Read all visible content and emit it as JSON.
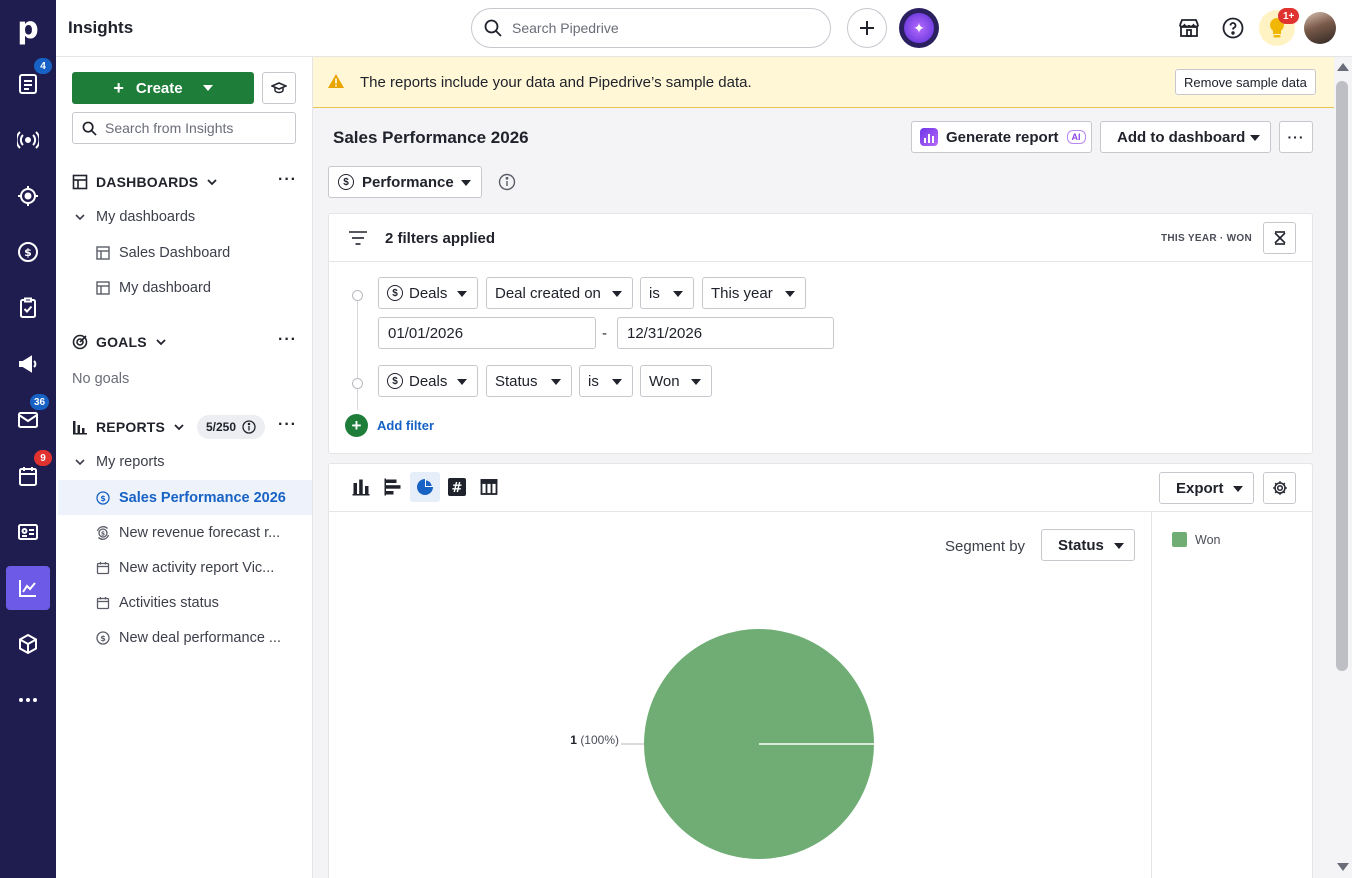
{
  "app": {
    "logo": "p",
    "title": "Insights"
  },
  "rail": {
    "badges": {
      "leads": "4",
      "mail": "36",
      "activities": "9"
    }
  },
  "topbar": {
    "search_placeholder": "Search Pipedrive",
    "notification_badge": "1+"
  },
  "sidebar": {
    "create_label": "Create",
    "search_placeholder": "Search from Insights",
    "dashboards": {
      "heading": "DASHBOARDS",
      "group": "My dashboards",
      "items": [
        "Sales Dashboard",
        "My dashboard"
      ]
    },
    "goals": {
      "heading": "GOALS",
      "empty": "No goals"
    },
    "reports": {
      "heading": "REPORTS",
      "count": "5/250",
      "group": "My reports",
      "items": [
        {
          "label": "Sales Performance 2026",
          "icon": "dollar-icon"
        },
        {
          "label": "New revenue forecast r...",
          "icon": "forecast-icon"
        },
        {
          "label": "New activity report Vic...",
          "icon": "calendar-icon"
        },
        {
          "label": "Activities status",
          "icon": "calendar-icon"
        },
        {
          "label": "New deal performance ...",
          "icon": "dollar-icon"
        }
      ]
    }
  },
  "banner": {
    "message": "The reports include your data and Pipedrive’s sample data.",
    "remove_label": "Remove sample data"
  },
  "report": {
    "title": "Sales Performance 2026",
    "generate_label": "Generate report",
    "ai_tag": "AI",
    "add_dashboard_label": "Add to dashboard",
    "type_label": "Performance"
  },
  "filters": {
    "summary": "2 filters applied",
    "tags": "THIS YEAR · WON",
    "rows": [
      {
        "entity": "Deals",
        "field": "Deal created on",
        "operator": "is",
        "value": "This year",
        "from": "01/01/2026",
        "to": "12/31/2026",
        "separator": "-"
      },
      {
        "entity": "Deals",
        "field": "Status",
        "operator": "is",
        "value": "Won"
      }
    ],
    "add_label": "Add filter"
  },
  "chart_toolbar": {
    "export_label": "Export",
    "segment_label": "Segment by",
    "segment_value": "Status"
  },
  "chart_data": {
    "type": "pie",
    "slices": [
      {
        "name": "Won",
        "value": 1,
        "percent": 100,
        "color": "#6fad74"
      }
    ],
    "data_label": {
      "count": "1",
      "percent": "(100%)"
    },
    "legend": [
      "Won"
    ],
    "legend_placement": "right"
  }
}
